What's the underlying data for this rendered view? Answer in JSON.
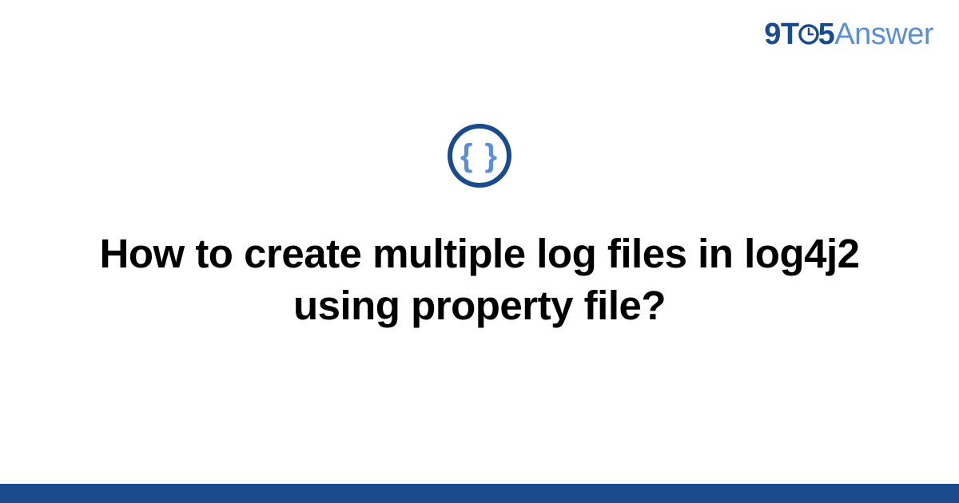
{
  "logo": {
    "part_9t": "9T",
    "part_5": "5",
    "part_answer": "Answer"
  },
  "icon": {
    "braces": "{ }"
  },
  "title": "How to create multiple log files in log4j2 using property file?",
  "colors": {
    "primary": "#1a4b8c",
    "secondary": "#5a8fd4"
  }
}
